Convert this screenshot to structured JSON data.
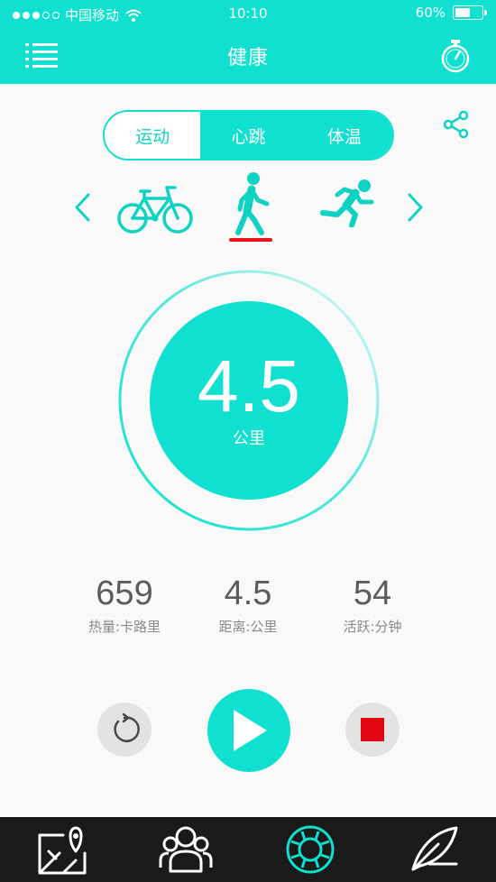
{
  "status_bar": {
    "carrier": "中国移动",
    "time": "10:10",
    "battery_percent": "60%",
    "battery_level": 0.6,
    "signal_bars_filled": 3,
    "signal_bars_total": 5
  },
  "header": {
    "title": "健康",
    "menu_icon": "list-menu-icon",
    "timer_icon": "stopwatch-icon"
  },
  "share_icon": "share-icon",
  "segments": [
    {
      "label": "运动",
      "active": false
    },
    {
      "label": "心跳",
      "active": true
    },
    {
      "label": "体温",
      "active": true
    }
  ],
  "modes": {
    "items": [
      "bicycle-icon",
      "walking-icon",
      "running-icon"
    ],
    "selected": "walking-icon"
  },
  "distance": {
    "value": "4.5",
    "unit": "公里"
  },
  "stats": [
    {
      "value": "659",
      "label": "热量:卡路里"
    },
    {
      "value": "4.5",
      "label": "距离:公里"
    },
    {
      "value": "54",
      "label": "活跃:分钟"
    }
  ],
  "controls": [
    "reset-icon",
    "play-icon",
    "stop-icon"
  ],
  "tabbar": [
    "map-icon",
    "group-icon",
    "lifebuoy-icon",
    "feather-icon"
  ],
  "colors": {
    "accent": "#0fe0cf",
    "underline": "#e8141d",
    "stop": "#e30613",
    "tabbar_bg": "#1a1a1a"
  }
}
